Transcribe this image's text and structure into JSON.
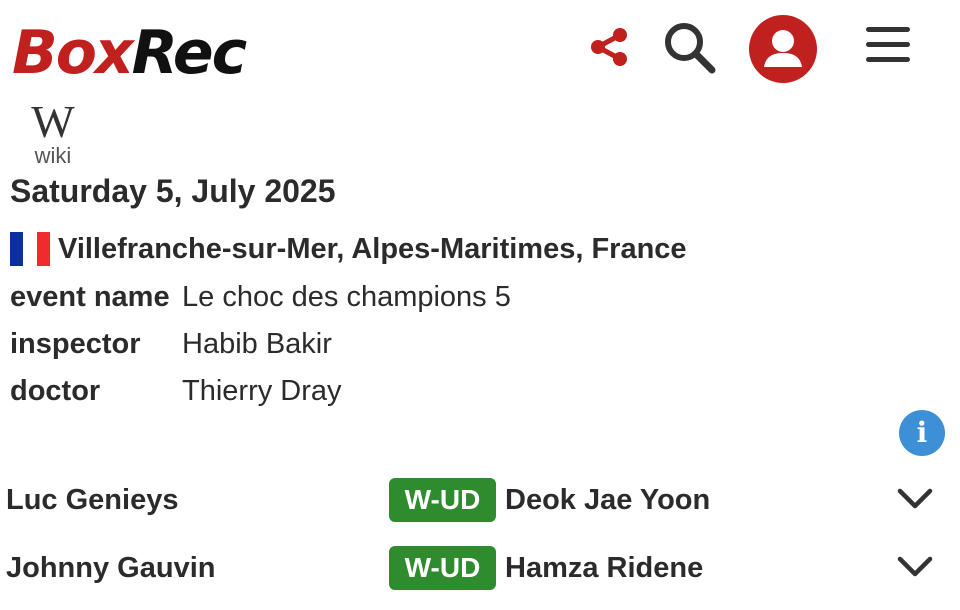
{
  "header": {
    "logo_part1": "Box",
    "logo_part2": "Rec",
    "icons": [
      "share-icon",
      "search-icon",
      "user-icon",
      "menu-icon"
    ],
    "brand_color": "#c0201e"
  },
  "wiki": {
    "glyph": "W",
    "label": "wiki"
  },
  "event": {
    "date": "Saturday 5, July 2025",
    "location": "Villefranche-sur-Mer, Alpes-Maritimes, France",
    "country_flag": "france-flag",
    "details": [
      {
        "key": "event name",
        "value": "Le choc des champions 5"
      },
      {
        "key": "inspector",
        "value": "Habib Bakir"
      },
      {
        "key": "doctor",
        "value": "Thierry Dray"
      }
    ]
  },
  "info_icon": "i",
  "bouts": [
    {
      "fighter1": "Luc Genieys",
      "result": "W-UD",
      "fighter2": "Deok Jae Yoon"
    },
    {
      "fighter1": "Johnny Gauvin",
      "result": "W-UD",
      "fighter2": "Hamza Ridene"
    }
  ],
  "colors": {
    "result_win": "#2e8b2e",
    "info": "#3d8fd6"
  }
}
